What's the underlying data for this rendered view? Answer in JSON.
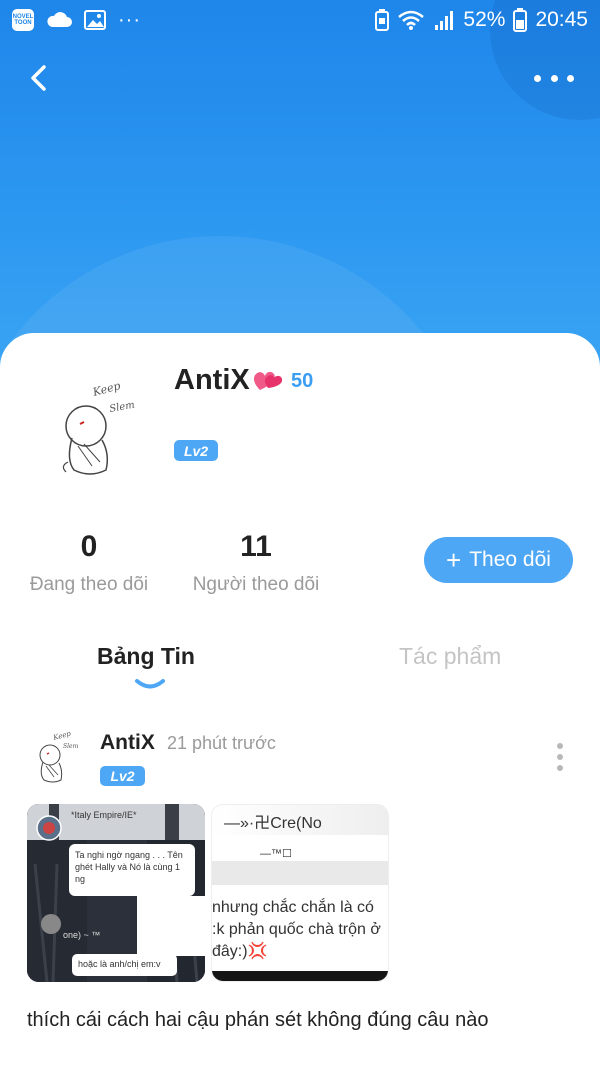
{
  "status_bar": {
    "app_badge": "NOVEL TOON",
    "more": "···",
    "battery_percent": "52%",
    "time": "20:45"
  },
  "profile": {
    "name": "AntiX",
    "heart_count": "50",
    "level": "Lv2"
  },
  "stats": {
    "following_count": "0",
    "following_label": "Đang theo dõi",
    "followers_count": "11",
    "followers_label": "Người theo dõi"
  },
  "follow_button": {
    "plus": "+",
    "label": "Theo dõi"
  },
  "tabs": [
    {
      "label": "Bảng Tin",
      "active": true
    },
    {
      "label": "Tác phẩm",
      "active": false
    }
  ],
  "post": {
    "author": "AntiX",
    "time": "21 phút trước",
    "level": "Lv2",
    "thumb1": {
      "top_text": "*Italy Empire/IE*",
      "bubble_text": "Ta nghi ngờ ngang . . . Tên ghét Hally và Nó là cùng 1 ng",
      "mid_text": "one) ~ ™",
      "bubble2_text": "hoặc là anh/chị em:v"
    },
    "thumb2": {
      "line1": "—»·卍Cre(No",
      "line2": "—™☐",
      "text_line1": "nhưng chắc chắn là có",
      "text_line2": ":k phản quốc chà trộn ở",
      "text_line3": "đây:)💢"
    },
    "caption": "thích cái cách hai cậu phán sét không đúng câu nào"
  },
  "colors": {
    "accent": "#4ea7f5",
    "header_top": "#1f86ea",
    "heart": "#f0467b",
    "muted": "#9a9a9a"
  },
  "icons": [
    "back-arrow-icon",
    "more-dots-icon",
    "heart-icon",
    "plus-icon",
    "vertical-dots-icon",
    "cloud-icon",
    "image-icon",
    "wifi-icon",
    "signal-icon",
    "battery-icon",
    "alarm-icon"
  ]
}
